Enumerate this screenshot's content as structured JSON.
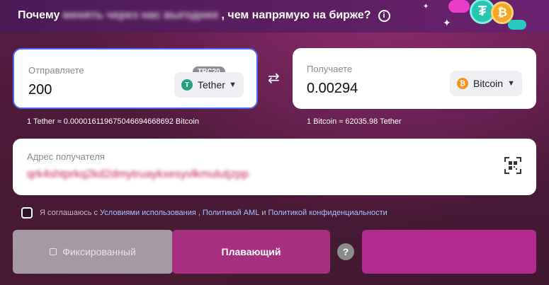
{
  "banner": {
    "prefix": "Почему",
    "blurred": "менять через нас выгоднее",
    "suffix": ", чем напрямую на бирже?",
    "info_icon": "i"
  },
  "send": {
    "label": "Отправляете",
    "amount": "200",
    "network_badge": "TRC20",
    "currency": "Tether",
    "currency_icon": "T",
    "rate": "1 Tether ≈ 0.0000161196750466946686​92 Bitcoin"
  },
  "receive": {
    "label": "Получаете",
    "amount": "0.00294",
    "currency": "Bitcoin",
    "currency_icon": "₿",
    "rate": "1 Bitcoin ≈ 62035.98 Tether"
  },
  "swap_icon": "⇄",
  "address": {
    "label": "Адрес получателя",
    "value": "qrk4shtprkq2kd2dmytruaykxesyvlkmulutjzpp"
  },
  "agreement": {
    "prefix": "Я соглашаюсь с",
    "link_terms": "Условиями использования",
    "sep1": ",",
    "link_aml": "Политикой AML",
    "and": "и",
    "link_privacy": "Политикой конфиденциальности"
  },
  "rate_type": {
    "fixed": "Фиксированный",
    "floating": "Плавающий",
    "help": "?"
  },
  "colors": {
    "accent": "#a62f80",
    "tether": "#26a17b",
    "bitcoin": "#f7931a"
  }
}
